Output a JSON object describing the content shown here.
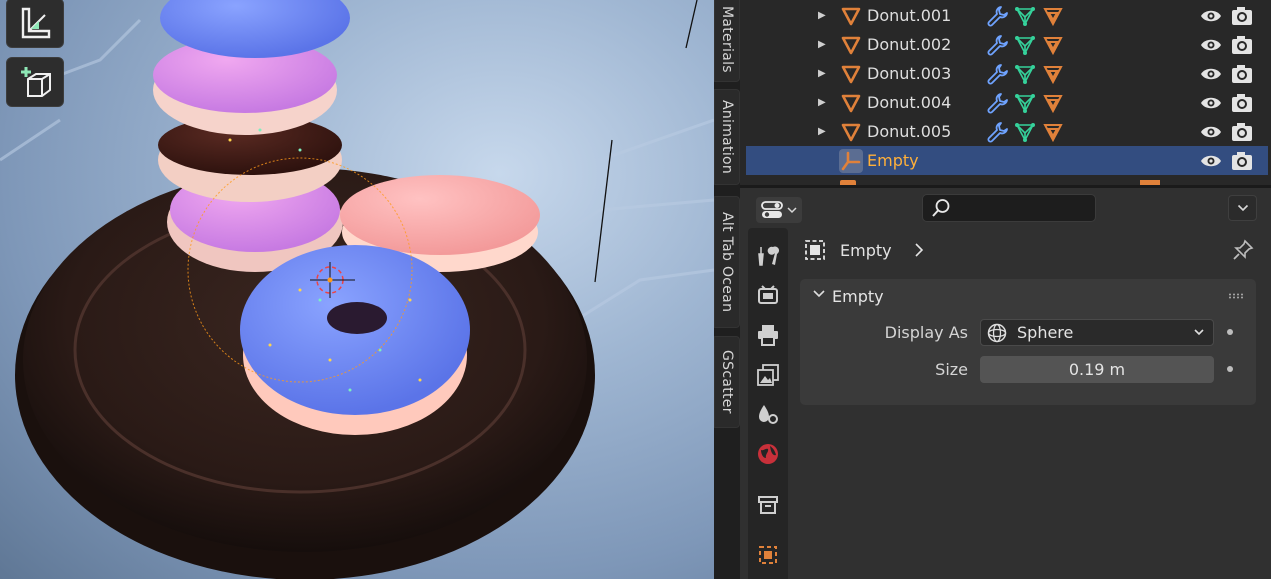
{
  "side_tabs": [
    {
      "label": "Materials"
    },
    {
      "label": "Animation"
    },
    {
      "label": "Alt Tab Ocean"
    },
    {
      "label": "GScatter"
    }
  ],
  "outliner": {
    "rows": [
      {
        "name": "Donut.001",
        "type": "mesh",
        "has_disclosure": true,
        "selected": false
      },
      {
        "name": "Donut.002",
        "type": "mesh",
        "has_disclosure": true,
        "selected": false
      },
      {
        "name": "Donut.003",
        "type": "mesh",
        "has_disclosure": true,
        "selected": false
      },
      {
        "name": "Donut.004",
        "type": "mesh",
        "has_disclosure": true,
        "selected": false
      },
      {
        "name": "Donut.005",
        "type": "mesh",
        "has_disclosure": true,
        "selected": false
      },
      {
        "name": "Empty",
        "type": "empty",
        "has_disclosure": false,
        "selected": true
      }
    ],
    "colors": {
      "selected_row": "#334d80",
      "selected_text": "#ffb03a",
      "mesh_icon": "#e0813a",
      "modifier_icon": "#6fa3ff",
      "vertex_group_icon": "#35d29b"
    }
  },
  "properties": {
    "search": {
      "placeholder": ""
    },
    "breadcrumb": {
      "object_name": "Empty"
    },
    "panel": {
      "title": "Empty",
      "display_as": {
        "label": "Display As",
        "value": "Sphere"
      },
      "size": {
        "label": "Size",
        "value": "0.19 m"
      }
    },
    "tabs": [
      "tool-icon",
      "render-icon",
      "output-icon",
      "view-layer-icon",
      "scene-icon",
      "world-icon",
      "collection-icon",
      "object-icon"
    ]
  }
}
